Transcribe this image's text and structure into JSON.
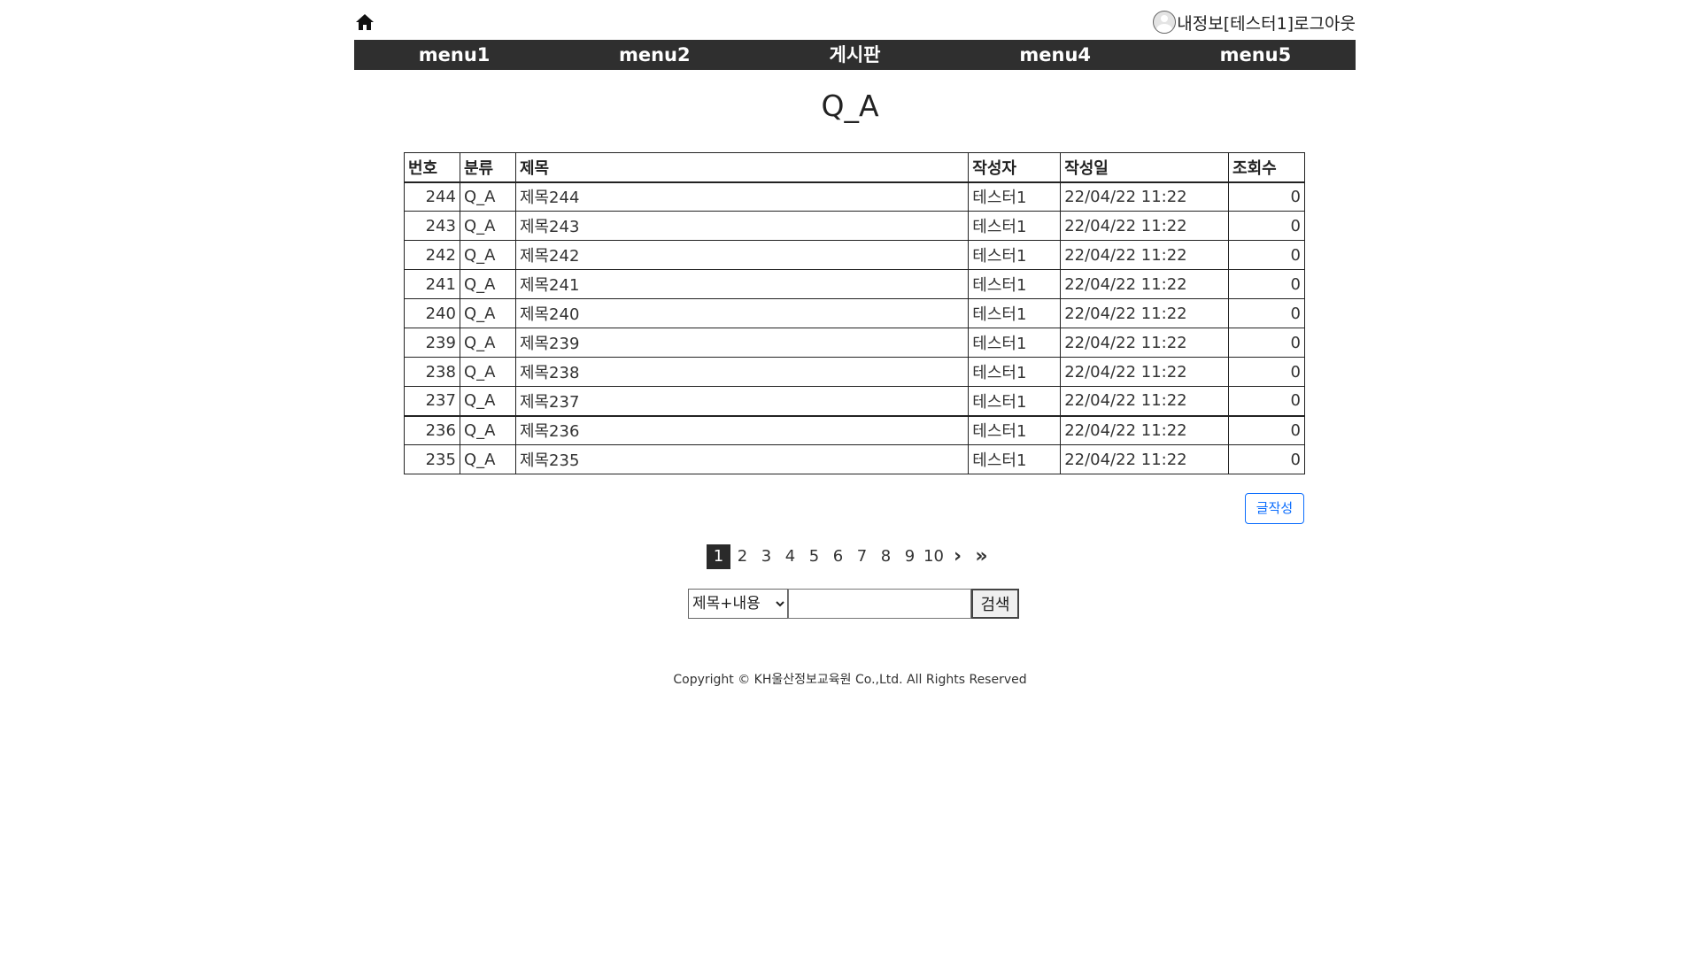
{
  "header": {
    "my_info": "내정보",
    "user_bracket": "[테스터1]",
    "logout": "로그아웃"
  },
  "nav": {
    "items": [
      {
        "label": "menu1"
      },
      {
        "label": "menu2"
      },
      {
        "label": "게시판"
      },
      {
        "label": "menu4"
      },
      {
        "label": "menu5"
      }
    ]
  },
  "board": {
    "title": "Q_A",
    "columns": [
      "번호",
      "분류",
      "제목",
      "작성자",
      "작성일",
      "조회수"
    ],
    "rows": [
      {
        "num": "244",
        "category": "Q_A",
        "title": "제목244",
        "author": "테스터1",
        "date": "22/04/22 11:22",
        "views": "0"
      },
      {
        "num": "243",
        "category": "Q_A",
        "title": "제목243",
        "author": "테스터1",
        "date": "22/04/22 11:22",
        "views": "0"
      },
      {
        "num": "242",
        "category": "Q_A",
        "title": "제목242",
        "author": "테스터1",
        "date": "22/04/22 11:22",
        "views": "0"
      },
      {
        "num": "241",
        "category": "Q_A",
        "title": "제목241",
        "author": "테스터1",
        "date": "22/04/22 11:22",
        "views": "0"
      },
      {
        "num": "240",
        "category": "Q_A",
        "title": "제목240",
        "author": "테스터1",
        "date": "22/04/22 11:22",
        "views": "0"
      },
      {
        "num": "239",
        "category": "Q_A",
        "title": "제목239",
        "author": "테스터1",
        "date": "22/04/22 11:22",
        "views": "0"
      },
      {
        "num": "238",
        "category": "Q_A",
        "title": "제목238",
        "author": "테스터1",
        "date": "22/04/22 11:22",
        "views": "0"
      },
      {
        "num": "237",
        "category": "Q_A",
        "title": "제목237",
        "author": "테스터1",
        "date": "22/04/22 11:22",
        "views": "0"
      },
      {
        "num": "236",
        "category": "Q_A",
        "title": "제목236",
        "author": "테스터1",
        "date": "22/04/22 11:22",
        "views": "0"
      },
      {
        "num": "235",
        "category": "Q_A",
        "title": "제목235",
        "author": "테스터1",
        "date": "22/04/22 11:22",
        "views": "0"
      }
    ],
    "write_label": "글작성"
  },
  "pagination": {
    "pages": [
      "1",
      "2",
      "3",
      "4",
      "5",
      "6",
      "7",
      "8",
      "9",
      "10"
    ],
    "current": "1",
    "next_label": "›",
    "last_label": "»"
  },
  "search": {
    "selected_option": "제목+내용",
    "value": "",
    "button_label": "검색"
  },
  "footer": {
    "copyright": "Copyright © KH울산정보교육원 Co.,Ltd. All Rights Reserved"
  },
  "icons": {
    "home": "home-icon",
    "avatar": "user-avatar-icon"
  },
  "colors": {
    "nav_bg": "#2f2f2f",
    "accent": "#0d6efd",
    "active_page": "#2a2a2a"
  }
}
